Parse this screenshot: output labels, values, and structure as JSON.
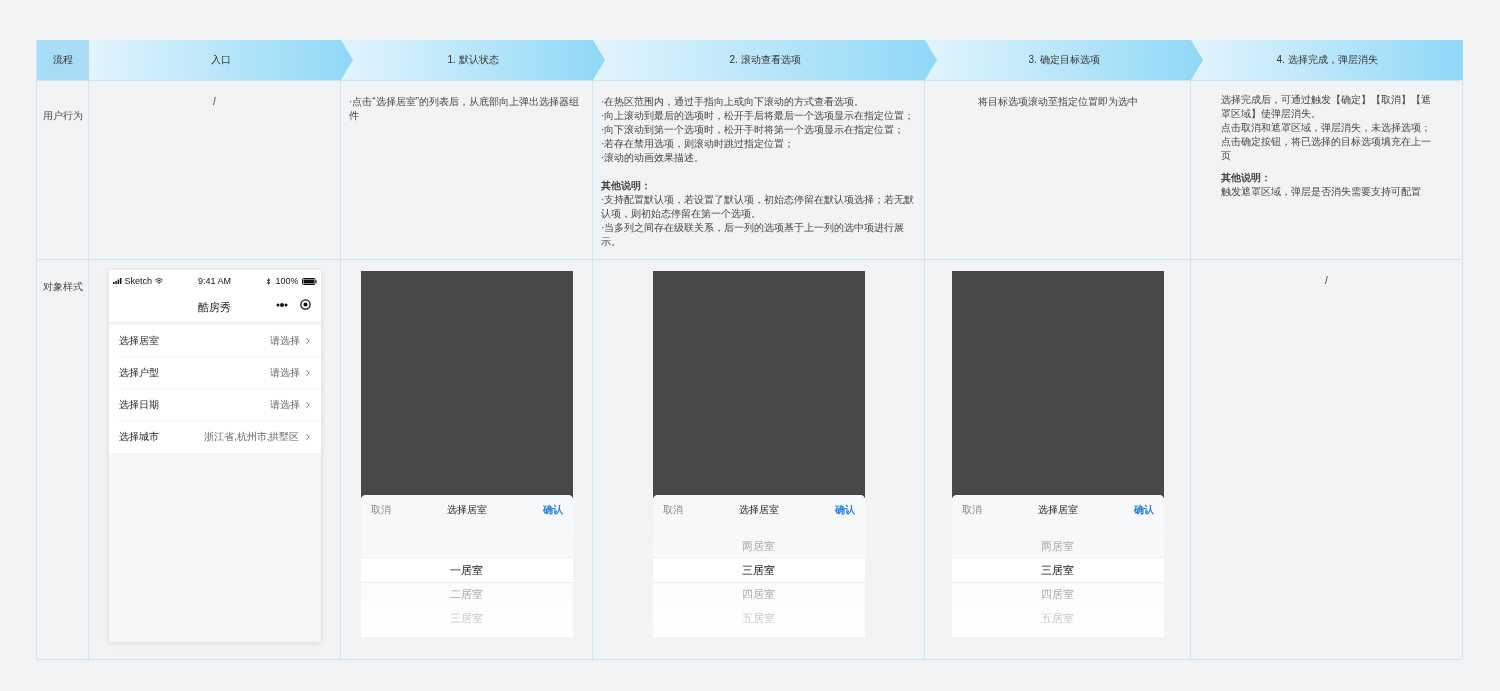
{
  "header": {
    "label": "流程",
    "steps": [
      "入口",
      "1. 默认状态",
      "2. 滚动查看选项",
      "3. 确定目标选项",
      "4. 选择完成，弹层消失"
    ]
  },
  "behavior": {
    "label": "用户行为",
    "cells": [
      {
        "kind": "note",
        "lines": [
          {
            "kind": "text",
            "text": "/"
          }
        ]
      },
      {
        "kind": "list",
        "lines": [
          {
            "kind": "text",
            "text": "·点击“选择居室”的列表后，从底部向上弹出选择器组件"
          }
        ]
      },
      {
        "kind": "list",
        "lines": [
          {
            "kind": "text",
            "text": "·在热区范围内，通过手指向上或向下滚动的方式查看选项。"
          },
          {
            "kind": "text",
            "text": "·向上滚动到最后的选项时，松开手后将最后一个选项显示在指定位置；"
          },
          {
            "kind": "text",
            "text": "·向下滚动到第一个选项时，松开手时将第一个选项显示在指定位置；"
          },
          {
            "kind": "text",
            "text": "·若存在禁用选项，则滚动时跳过指定位置；"
          },
          {
            "kind": "text",
            "text": "·滚动的动画效果描述。"
          },
          {
            "kind": "heading",
            "text": "其他说明："
          },
          {
            "kind": "text",
            "text": "·支持配置默认项，若设置了默认项，初始态停留在默认项选择；若无默认项，则初始态停留在第一个选项。"
          },
          {
            "kind": "text",
            "text": "·当多列之间存在级联关系，后一列的选项基于上一列的选中项进行展示。"
          }
        ]
      },
      {
        "kind": "note",
        "lines": [
          {
            "kind": "text",
            "text": "将目标选项滚动至指定位置即为选中"
          }
        ]
      },
      {
        "kind": "para",
        "lines": [
          {
            "kind": "text",
            "text": "选择完成后，可通过触发【确定】【取消】【遮罩区域】使弹层消失。"
          },
          {
            "kind": "text",
            "text": "点击取消和遮罩区域，弹层消失，未选择选项；点击确定按钮，将已选择的目标选项填充在上一页"
          },
          {
            "kind": "heading",
            "text": "其他说明："
          },
          {
            "kind": "text",
            "text": "触发遮罩区域，弹层是否消失需要支持可配置"
          }
        ]
      }
    ]
  },
  "style": {
    "label": "对象样式",
    "cells": [
      {
        "kind": "phone",
        "status": {
          "carrier": "Sketch",
          "time": "9:41 AM",
          "battery": "100%"
        },
        "title": "酷房秀",
        "rows": [
          {
            "label": "选择居室",
            "value": "请选择"
          },
          {
            "label": "选择户型",
            "value": "请选择"
          },
          {
            "label": "选择日期",
            "value": "请选择"
          },
          {
            "label": "选择城市",
            "value": "浙江省,杭州市,拱墅区"
          }
        ]
      },
      {
        "kind": "picker",
        "cancel": "取消",
        "title": "选择居室",
        "confirm": "确认",
        "options": [
          {
            "label": "一居室",
            "selected": true
          },
          {
            "label": "二居室",
            "selected": false
          },
          {
            "label": "三居室",
            "selected": false
          }
        ]
      },
      {
        "kind": "picker",
        "cancel": "取消",
        "title": "选择居室",
        "confirm": "确认",
        "options": [
          {
            "label": "两居室",
            "selected": false
          },
          {
            "label": "三居室",
            "selected": true
          },
          {
            "label": "四居室",
            "selected": false
          },
          {
            "label": "五居室",
            "selected": false
          }
        ]
      },
      {
        "kind": "picker",
        "cancel": "取消",
        "title": "选择居室",
        "confirm": "确认",
        "options": [
          {
            "label": "两居室",
            "selected": false
          },
          {
            "label": "三居室",
            "selected": true
          },
          {
            "label": "四居室",
            "selected": false
          },
          {
            "label": "五居室",
            "selected": false
          }
        ]
      },
      {
        "kind": "note",
        "lines": [
          {
            "kind": "text",
            "text": "/"
          }
        ]
      }
    ]
  }
}
